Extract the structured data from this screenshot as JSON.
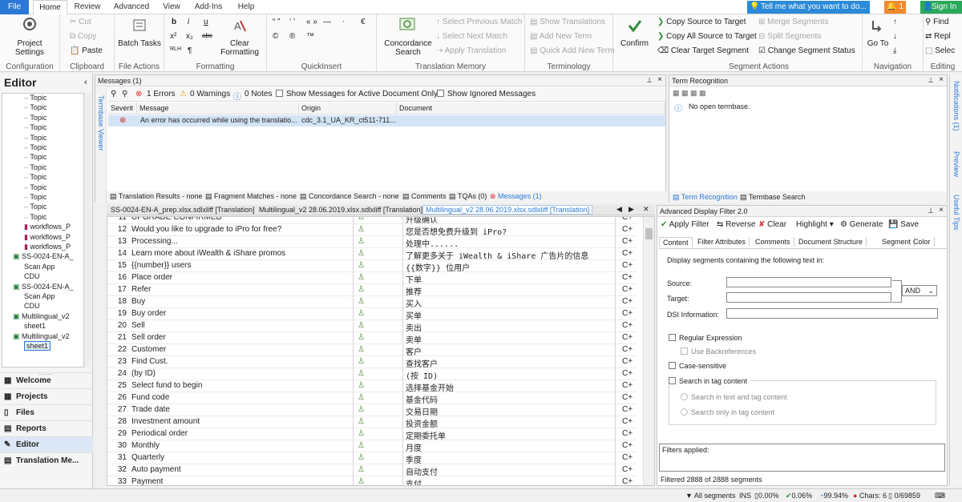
{
  "tabs": [
    "File",
    "Home",
    "Review",
    "Advanced",
    "View",
    "Add-Ins",
    "Help"
  ],
  "tell_me": "Tell me what you want to do...",
  "notif_count": "1",
  "sign_in": "Sign In",
  "ribbon": {
    "configuration": {
      "label": "Configuration",
      "project_settings": "Project Settings"
    },
    "clipboard": {
      "label": "Clipboard",
      "cut": "Cut",
      "copy": "Copy",
      "paste": "Paste"
    },
    "file_actions": {
      "label": "File Actions",
      "batch_tasks": "Batch Tasks"
    },
    "formatting": {
      "label": "Formatting",
      "bold": "b",
      "italic": "i",
      "underline": "u",
      "superscript": "x²",
      "subscript": "x₂",
      "abc": "abc",
      "rtl": "RLH",
      "pilcrow": "¶",
      "clear": "Clear Formatting"
    },
    "quickinsert": {
      "label": "QuickInsert",
      "copyright": "©",
      "registered": "®",
      "trademark": "™",
      "euro": "€"
    },
    "tm": {
      "label": "Translation Memory",
      "concordance": "Concordance Search",
      "prev_match": "Select Previous Match",
      "next_match": "Select Next Match",
      "apply": "Apply Translation"
    },
    "terminology": {
      "label": "Terminology",
      "show": "Show Translations",
      "add": "Add New Term",
      "quick": "Quick Add New Term"
    },
    "confirm": "Confirm",
    "segment_actions": {
      "label": "Segment Actions",
      "copy_source": "Copy Source to Target",
      "copy_all": "Copy All Source to Target",
      "clear_target": "Clear Target Segment",
      "merge": "Merge Segments",
      "split": "Split Segments",
      "change_status": "Change Segment Status"
    },
    "navigation": {
      "label": "Navigation",
      "goto": "Go To"
    },
    "editing": {
      "label": "Editing",
      "find": "Find",
      "replace": "Repl",
      "select": "Selec"
    }
  },
  "nav": {
    "title": "Editor",
    "tree": [
      "Topic",
      "Topic",
      "Topic",
      "Topic",
      "Topic",
      "Topic",
      "Topic",
      "Topic",
      "Topic",
      "Topic",
      "Topic",
      "Topic",
      "Topic",
      "workflows_P",
      "workflows_P",
      "workflows_P",
      "SS-0024-EN-A_",
      "Scan App",
      "CDU",
      "SS-0024-EN-A_",
      "Scan App",
      "CDU",
      "Multilingual_v2",
      "sheet1",
      "Multilingual_v2",
      "sheet1"
    ],
    "buttons": [
      "Welcome",
      "Projects",
      "Files",
      "Reports",
      "Editor",
      "Translation Me..."
    ]
  },
  "messages": {
    "title": "Messages (1)",
    "errors": "1 Errors",
    "warnings": "0 Warnings",
    "notes": "0 Notes",
    "show_active": "Show Messages for Active Document Only",
    "show_ignored": "Show Ignored Messages",
    "columns": [
      "Severit",
      "Message",
      "Origin",
      "Document"
    ],
    "row": {
      "message": "An error has occurred while using the translatio...",
      "origin": "cdc_3.1_UA_KR_ct511-711..."
    },
    "side_label": "Termbase Viewer"
  },
  "bottom_tabs": [
    "Translation Results - none",
    "Fragment Matches - none",
    "Concordance Search - none",
    "Comments",
    "TQAs (0)",
    "Messages (1)"
  ],
  "term": {
    "title": "Term Recognition",
    "no_termbase": "No open termbase.",
    "tab1": "Term Recognition",
    "tab2": "Termbase Search"
  },
  "doc_tabs": [
    "SS-0024-EN-A_prep.xlsx.sdlxliff [Translation]",
    "Multilingual_v2 28.06.2019.xlsx.sdlxliff [Translation]",
    "Multilingual_v2 28.06.2019.xlsx.sdlxliff [Translation]"
  ],
  "segments": [
    {
      "n": "11",
      "src": "UPGRADE CONFIRMED",
      "tgt": "升级确认",
      "st": "C+"
    },
    {
      "n": "12",
      "src": "Would you like to upgrade to iPro for free?",
      "tgt": "您是否想免费升级到 iPro?",
      "st": "C+"
    },
    {
      "n": "13",
      "src": "Processing...",
      "tgt": "处理中......",
      "st": "C+"
    },
    {
      "n": "14",
      "src": "Learn more about iWealth & iShare promos",
      "tgt": "了解更多关于 iWealth & iShare 广告片的信息",
      "st": "C+"
    },
    {
      "n": "15",
      "src": "{{number}} users",
      "tgt": "{{数字}} 位用户",
      "st": "C+"
    },
    {
      "n": "16",
      "src": "Place order",
      "tgt": "下单",
      "st": "C+"
    },
    {
      "n": "17",
      "src": "Refer",
      "tgt": "推荐",
      "st": "C+"
    },
    {
      "n": "18",
      "src": "Buy",
      "tgt": "买入",
      "st": "C+"
    },
    {
      "n": "19",
      "src": "Buy order",
      "tgt": "买单",
      "st": "C+"
    },
    {
      "n": "20",
      "src": "Sell",
      "tgt": "卖出",
      "st": "C+"
    },
    {
      "n": "21",
      "src": "Sell order",
      "tgt": "卖单",
      "st": "C+"
    },
    {
      "n": "22",
      "src": "Customer",
      "tgt": "客户",
      "st": "C+"
    },
    {
      "n": "23",
      "src": "Find Cust.",
      "tgt": "查找客户",
      "st": "C+"
    },
    {
      "n": "24",
      "src": "(by ID)",
      "tgt": "(按 ID)",
      "st": "C+"
    },
    {
      "n": "25",
      "src": "Select fund to begin",
      "tgt": "选择基金开始",
      "st": "C+"
    },
    {
      "n": "26",
      "src": "Fund code",
      "tgt": "基金代码",
      "st": "C+"
    },
    {
      "n": "27",
      "src": "Trade date",
      "tgt": "交易日期",
      "st": "C+"
    },
    {
      "n": "28",
      "src": "Investment amount",
      "tgt": "投资金额",
      "st": "C+"
    },
    {
      "n": "29",
      "src": "Periodical order",
      "tgt": "定期委托单",
      "st": "C+"
    },
    {
      "n": "30",
      "src": "Monthly",
      "tgt": "月度",
      "st": "C+"
    },
    {
      "n": "31",
      "src": "Quarterly",
      "tgt": "季度",
      "st": "C+"
    },
    {
      "n": "32",
      "src": "Auto payment",
      "tgt": "自动支付",
      "st": "C+"
    },
    {
      "n": "33",
      "src": "Payment",
      "tgt": "支付",
      "st": "C+"
    }
  ],
  "filter": {
    "title": "Advanced Display Filter 2.0",
    "apply": "Apply Filter",
    "reverse": "Reverse",
    "clear": "Clear",
    "highlight": "Highlight",
    "generate": "Generate",
    "save": "Save",
    "tabs": [
      "Content",
      "Filter Attributes",
      "Comments",
      "Document Structure",
      "Segment",
      "Color"
    ],
    "desc": "Display segments containing the following text in:",
    "source": "Source:",
    "target": "Target:",
    "dsi": "DSI Information:",
    "and": "AND",
    "regex": "Regular Expression",
    "backref": "Use Backreferences",
    "case": "Case-sensitive",
    "tag": "Search in tag content",
    "tag_both": "Search in text and tag content",
    "tag_only": "Search only in tag content",
    "applied": "Filters applied:",
    "filtered": "Filtered 2888 of 2888 segments"
  },
  "right_bar": [
    "Notifications (1)",
    "Preview",
    "Useful Tips"
  ],
  "status": {
    "segments": "All segments",
    "ins": "INS",
    "p1": "0.00%",
    "p2": "0.06%",
    "p3": "99.94%",
    "chars": "Chars: 6",
    "words": "0/69859"
  }
}
